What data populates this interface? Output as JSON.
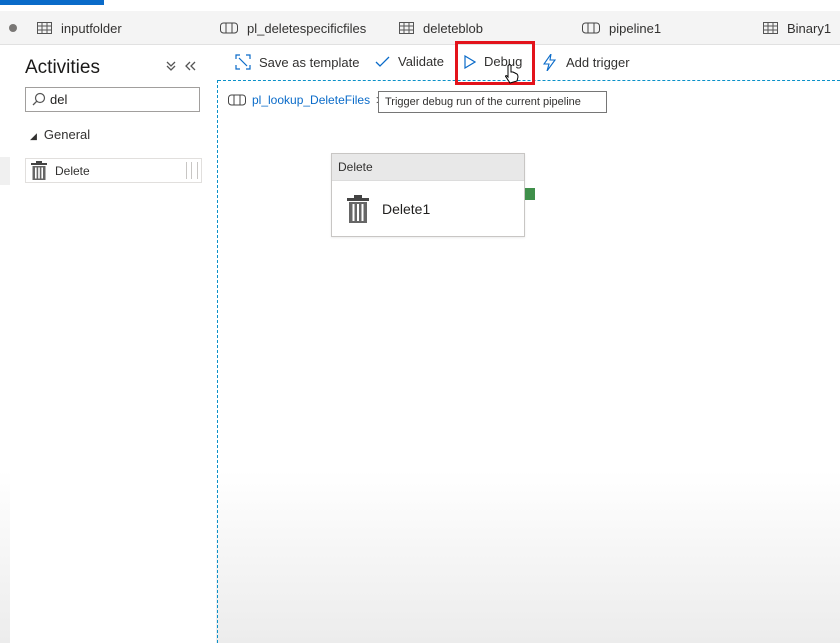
{
  "tabs": [
    {
      "label": "inputfolder",
      "icon": "table-icon"
    },
    {
      "label": "pl_deletespecificfiles",
      "icon": "pipeline-icon"
    },
    {
      "label": "deleteblob",
      "icon": "table-icon"
    },
    {
      "label": "pipeline1",
      "icon": "pipeline-icon"
    },
    {
      "label": "Binary1",
      "icon": "table-icon"
    }
  ],
  "sidebar": {
    "title": "Activities",
    "collapse_icon": "double-chevron-down-icon",
    "hide_icon": "double-chevron-left-icon",
    "search_value": "del",
    "group": "General",
    "activity": "Delete"
  },
  "toolbar": {
    "save_template": "Save as template",
    "validate": "Validate",
    "debug": "Debug",
    "add_trigger": "Add trigger"
  },
  "breadcrumb": {
    "pipeline": "pl_lookup_DeleteFiles",
    "separator": ">"
  },
  "tooltip": "Trigger debug run of the current pipeline",
  "canvas": {
    "node_type": "Delete",
    "node_name": "Delete1"
  },
  "colors": {
    "accent": "#0a6bc9",
    "highlight": "#e3131b",
    "port": "#3f8f4a"
  }
}
